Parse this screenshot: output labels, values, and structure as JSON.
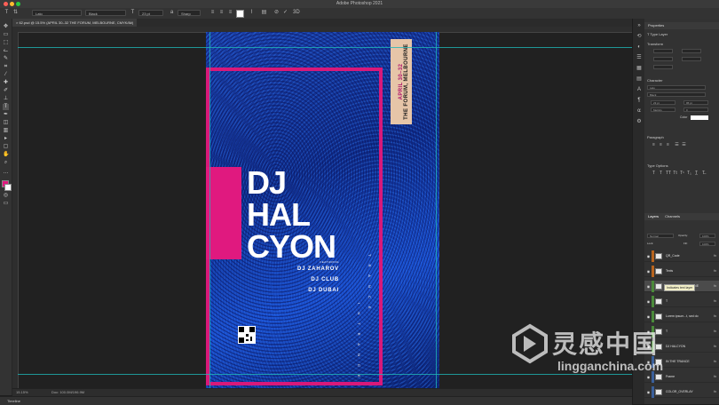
{
  "window": {
    "title": "Adobe Photoshop 2021"
  },
  "options_bar": {
    "font_family": "Lato",
    "font_style": "Black",
    "font_size": "23 pt",
    "antialias": "Sharp"
  },
  "document": {
    "tab_label": "62.psd @ 15.5% (APRIL 30–32 THE FORUM, MELBOURNE, CMYK/8#)",
    "zoom": "15.15%",
    "doc_info": "Doc: 100.0M/196.9M"
  },
  "poster": {
    "line1": "DJ",
    "line2": "HAL",
    "line3": "CYON",
    "featuring": "FEATURING",
    "artist1": "DJ ZAHAROV",
    "artist2": "DJ CLUB",
    "artist3": "DJ DUBAI",
    "date_line1": "APRIL 30–32",
    "date_line2": "THE FORUM, MELBOURNE",
    "vertical_left": "I N T R A N C E",
    "vertical_right": "T R A N C E"
  },
  "properties_panel": {
    "title": "Properties",
    "layer_type": "Type Layer",
    "transform": "Transform",
    "character": "Character",
    "font": "Lato",
    "style": "Black",
    "size": "23 pt",
    "leading": "95 pt",
    "tracking": "Metrics",
    "tracking_val": "0",
    "color_label": "Color",
    "paragraph": "Paragraph",
    "type_options": "Type Options"
  },
  "layers_panel": {
    "tab_layers": "Layers",
    "tab_channels": "Channels",
    "blend": "Normal",
    "opacity_label": "Opacity:",
    "opacity": "100%",
    "fill_label": "Fill:",
    "fill": "100%",
    "lock_label": "Lock:",
    "tooltip": "Indicates text layer",
    "layers": [
      {
        "name": "QR_Code",
        "color": "#b8641e"
      },
      {
        "name": "Texts",
        "color": "#b8641e"
      },
      {
        "name": "APRIL 30...ELBOURNE",
        "color": "#4a8a3a"
      },
      {
        "name": "T",
        "color": "#4a8a3a"
      },
      {
        "name": "Lorem ipsum...t, sed do",
        "color": "#4a8a3a"
      },
      {
        "name": "T",
        "color": "#4a8a3a"
      },
      {
        "name": "DJ HALCYON",
        "color": "#4a8a3a"
      },
      {
        "name": "IN THE TRANCE",
        "color": "#3a5f9a"
      },
      {
        "name": "Frame",
        "color": "#3a5f9a"
      },
      {
        "name": "COLOR_OVERLAY",
        "color": "#3a5f9a"
      }
    ]
  },
  "bottom": {
    "timeline": "Timeline"
  },
  "watermark": {
    "cn": "灵感中国",
    "url": "lingganchina.com"
  },
  "colors": {
    "accent_pink": "#d8197a",
    "guide": "#1fb5b5",
    "poster_blue": "#1b3fa8"
  }
}
